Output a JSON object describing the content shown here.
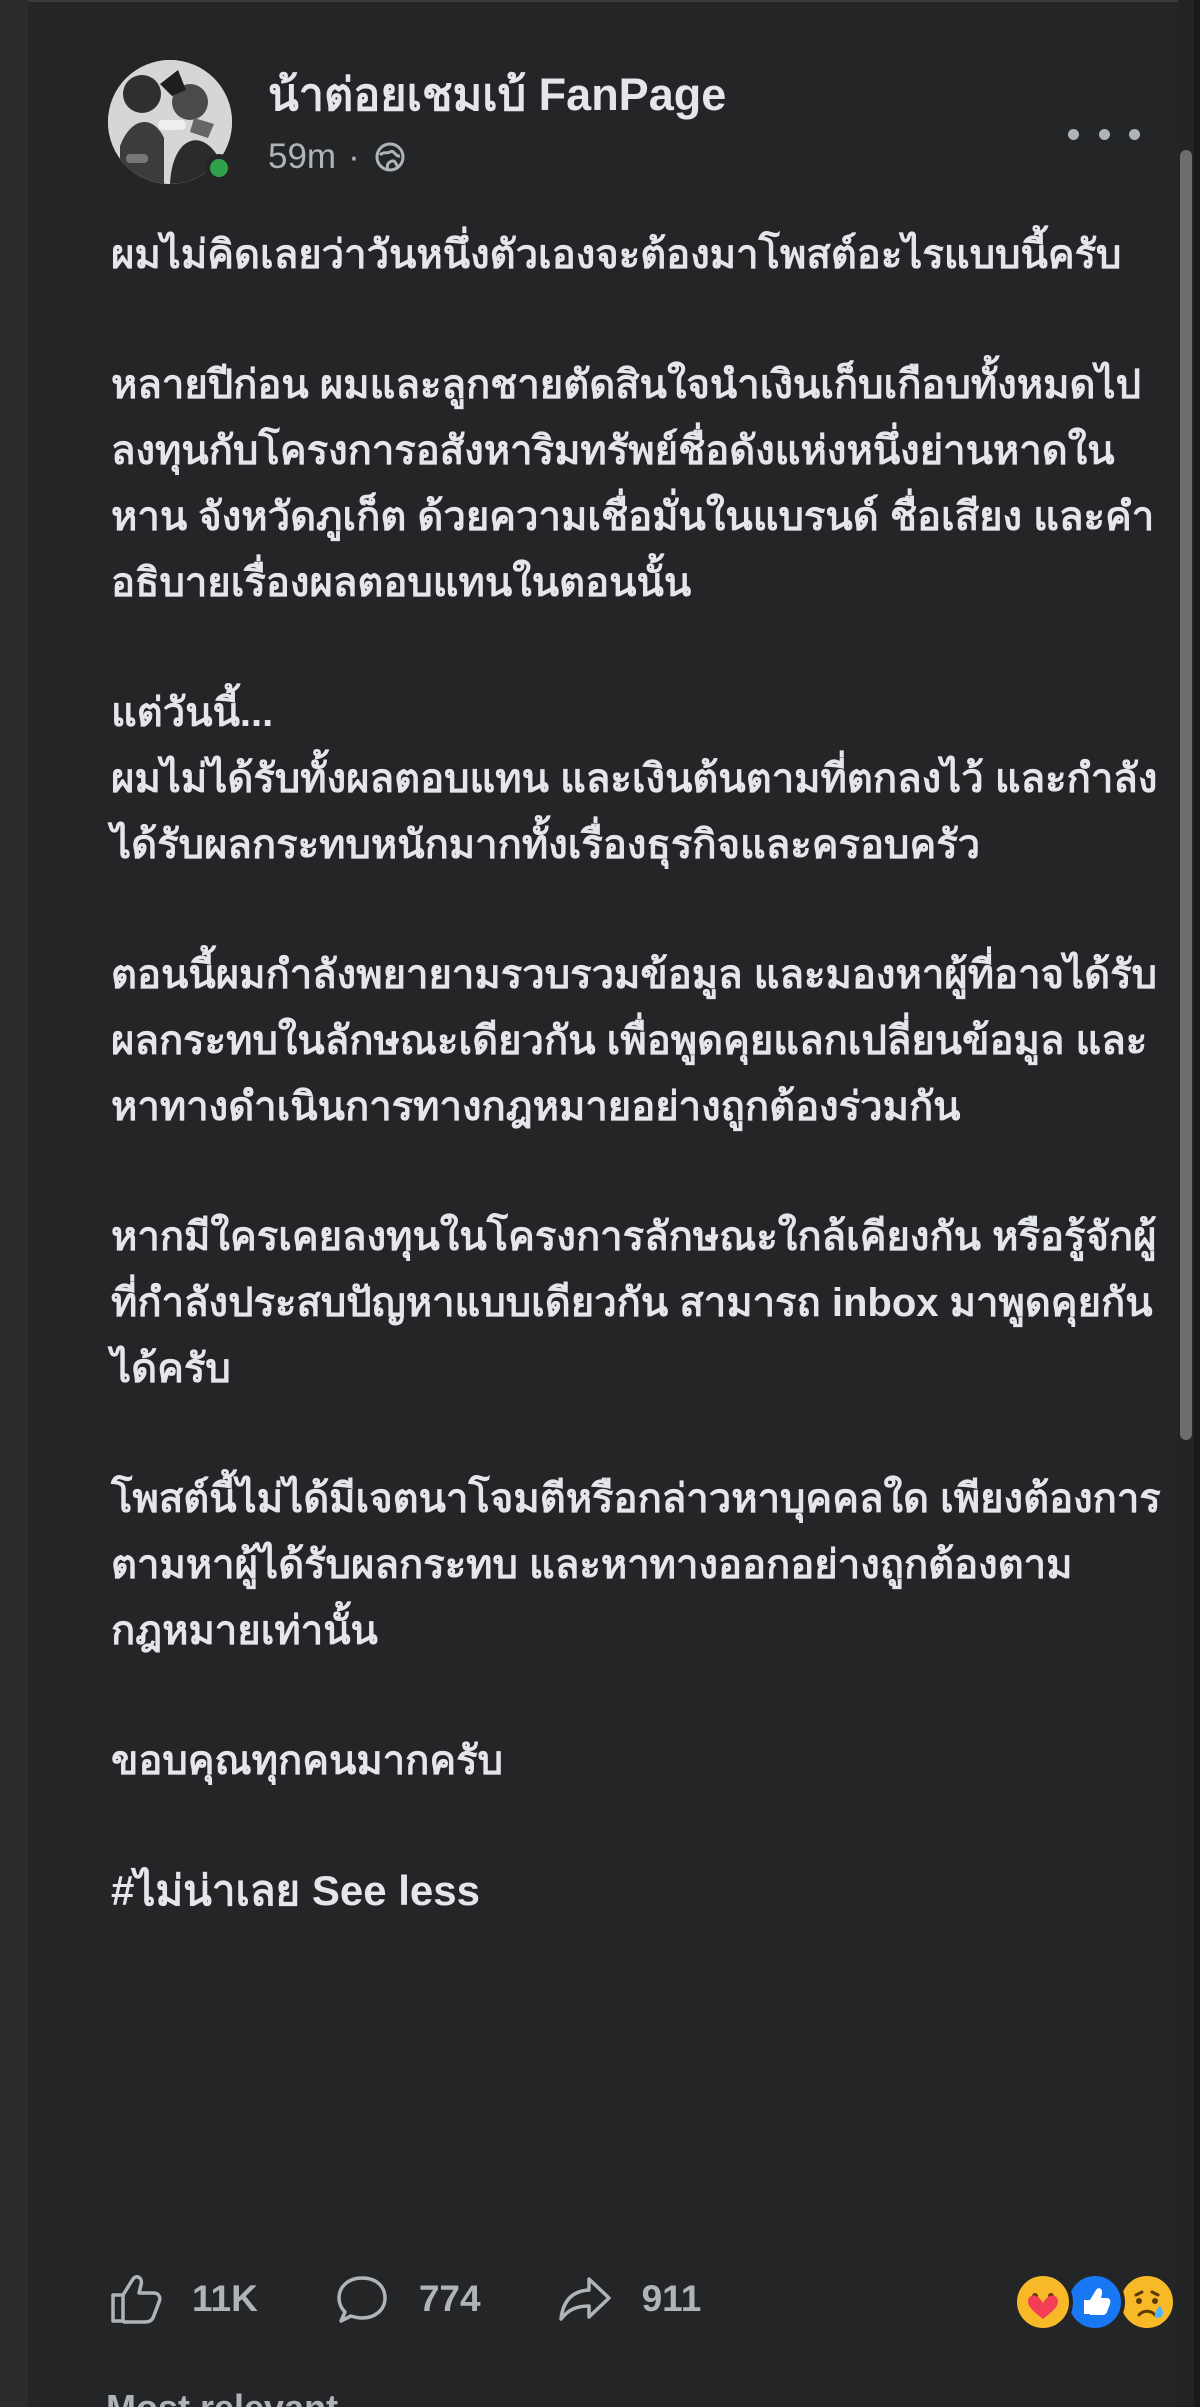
{
  "post": {
    "page_name": "น้าต่อยเชมเบ้ FanPage",
    "time": "59m",
    "separator": "·",
    "privacy_icon": "globe-icon",
    "more_icon": "more-dots-icon",
    "online_status_color": "#31a24c",
    "paragraphs": [
      "ผมไม่คิดเลยว่าวันหนึ่งตัวเองจะต้องมาโพสต์อะไรแบบนี้ครับ",
      "หลายปีก่อน ผมและลูกชายตัดสินใจนำเงินเก็บเกือบทั้งหมดไปลงทุนกับโครงการอสังหาริมทรัพย์ชื่อดังแห่งหนึ่งย่านหาดในหาน จังหวัดภูเก็ต ด้วยความเชื่อมั่นในแบรนด์ ชื่อเสียง และคำอธิบายเรื่องผลตอบแทนในตอนนั้น",
      "แต่วันนี้...\nผมไม่ได้รับทั้งผลตอบแทน และเงินต้นตามที่ตกลงไว้ และกำลังได้รับผลกระทบหนักมากทั้งเรื่องธุรกิจและครอบครัว",
      "ตอนนี้ผมกำลังพยายามรวบรวมข้อมูล และมองหาผู้ที่อาจได้รับผลกระทบในลักษณะเดียวกัน เพื่อพูดคุยแลกเปลี่ยนข้อมูล และหาทางดำเนินการทางกฎหมายอย่างถูกต้องร่วมกัน",
      "หากมีใครเคยลงทุนในโครงการลักษณะใกล้เคียงกัน หรือรู้จักผู้ที่กำลังประสบปัญหาแบบเดียวกัน สามารถ inbox มาพูดคุยกันได้ครับ",
      "โพสต์นี้ไม่ได้มีเจตนาโจมตีหรือกล่าวหาบุคคลใด เพียงต้องการตามหาผู้ได้รับผลกระทบ และหาทางออกอย่างถูกต้องตามกฎหมายเท่านั้น",
      "ขอบคุณทุกคนมากครับ"
    ],
    "hashtag": "#ไม่น่าเลย",
    "see_less": "See less"
  },
  "actions": {
    "likes": "11K",
    "comments": "774",
    "shares": "911",
    "like_icon": "thumb-up-icon",
    "comment_icon": "comment-bubble-icon",
    "share_icon": "share-arrow-icon"
  },
  "reactions": {
    "items": [
      "care",
      "like",
      "sad"
    ],
    "colors": {
      "care": "#f7b928",
      "like": "#1877f2",
      "sad": "#f7b928"
    }
  },
  "partial_footer_text": "Most relevant"
}
